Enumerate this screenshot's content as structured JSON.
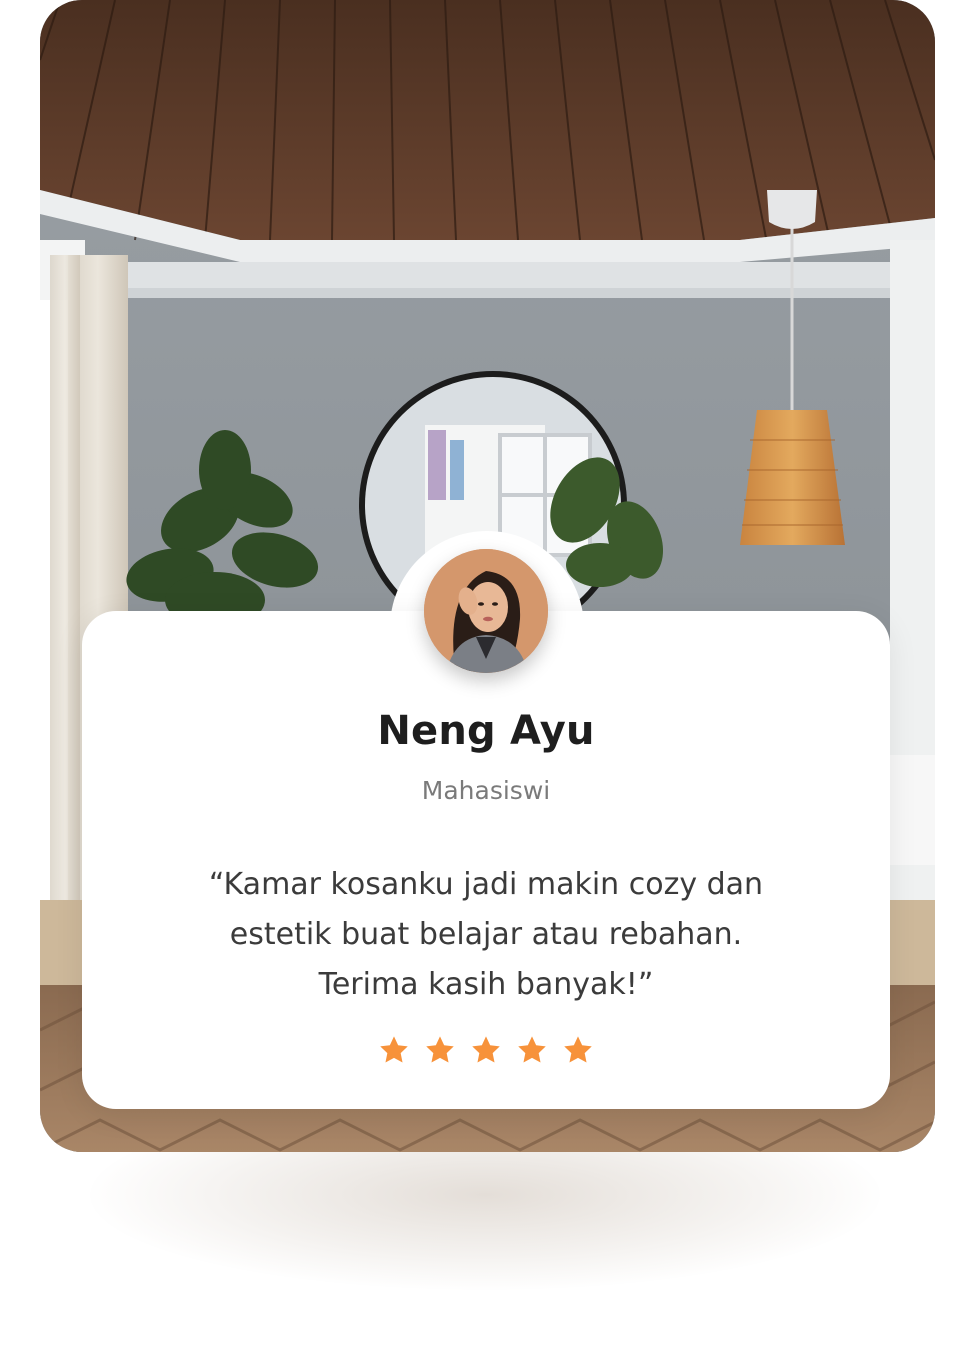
{
  "testimonial": {
    "name": "Neng Ayu",
    "role": "Mahasiswi",
    "quote": "“Kamar kosanku jadi makin cozy dan estetik buat belajar atau rebahan. Terima kasih banyak!”",
    "rating": 5,
    "rating_max": 5,
    "star_color": "#f7923a"
  },
  "icons": {
    "star": "star-icon",
    "avatar": "avatar-photo"
  },
  "colors": {
    "card_background": "#ffffff",
    "name_text": "#1e1e1e",
    "role_text": "#7a7a7a",
    "quote_text": "#3b3b3b"
  }
}
